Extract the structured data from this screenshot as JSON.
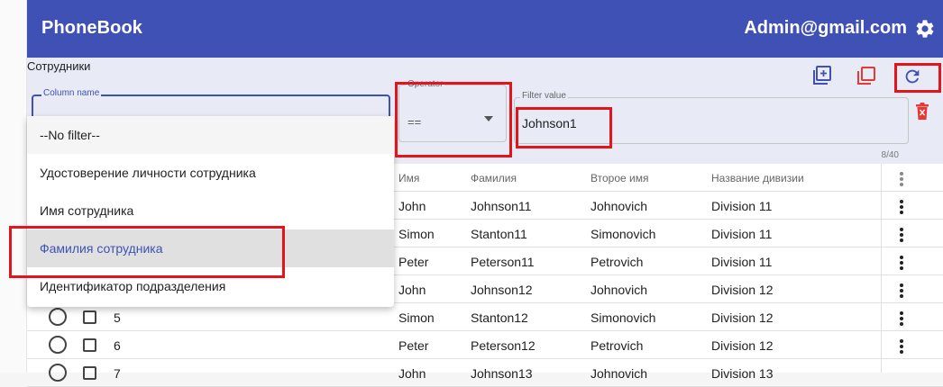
{
  "app": {
    "brand": "PhoneBook",
    "user": "Admin@gmail.com"
  },
  "panel": {
    "caption": "Сотрудники"
  },
  "filter": {
    "column_label": "Column name",
    "operator_label": "Operator",
    "operator_value": "==",
    "value_label": "Filter value",
    "value": "Johnson1",
    "counter": "8/40"
  },
  "dropdown": {
    "options": [
      "--No filter--",
      "Удостоверение личности сотрудника",
      "Имя сотрудника",
      "Фамилия сотрудника",
      "Идентификатор подразделения"
    ],
    "selected_index": 3
  },
  "table": {
    "headers": [
      "Имя",
      "Фамилия",
      "Второе имя",
      "Название дивизии"
    ],
    "rows": [
      {
        "id": "",
        "first": "John",
        "last": "Johnson11",
        "middle": "Johnovich",
        "division": "Division 11"
      },
      {
        "id": "",
        "first": "Simon",
        "last": "Stanton11",
        "middle": "Simonovich",
        "division": "Division 11"
      },
      {
        "id": "",
        "first": "Peter",
        "last": "Peterson11",
        "middle": "Petrovich",
        "division": "Division 11"
      },
      {
        "id": "",
        "first": "John",
        "last": "Johnson12",
        "middle": "Johnovich",
        "division": "Division 12"
      },
      {
        "id": "5",
        "first": "Simon",
        "last": "Stanton12",
        "middle": "Simonovich",
        "division": "Division 12"
      },
      {
        "id": "6",
        "first": "Peter",
        "last": "Peterson12",
        "middle": "Petrovich",
        "division": "Division 12"
      },
      {
        "id": "7",
        "first": "John",
        "last": "Johnson13",
        "middle": "Johnovich",
        "division": "Division 13"
      }
    ]
  },
  "colors": {
    "primary": "#3f51b5",
    "panel_bg": "#e8eaf6",
    "highlight": "#e3141b",
    "delete": "#e53935"
  }
}
